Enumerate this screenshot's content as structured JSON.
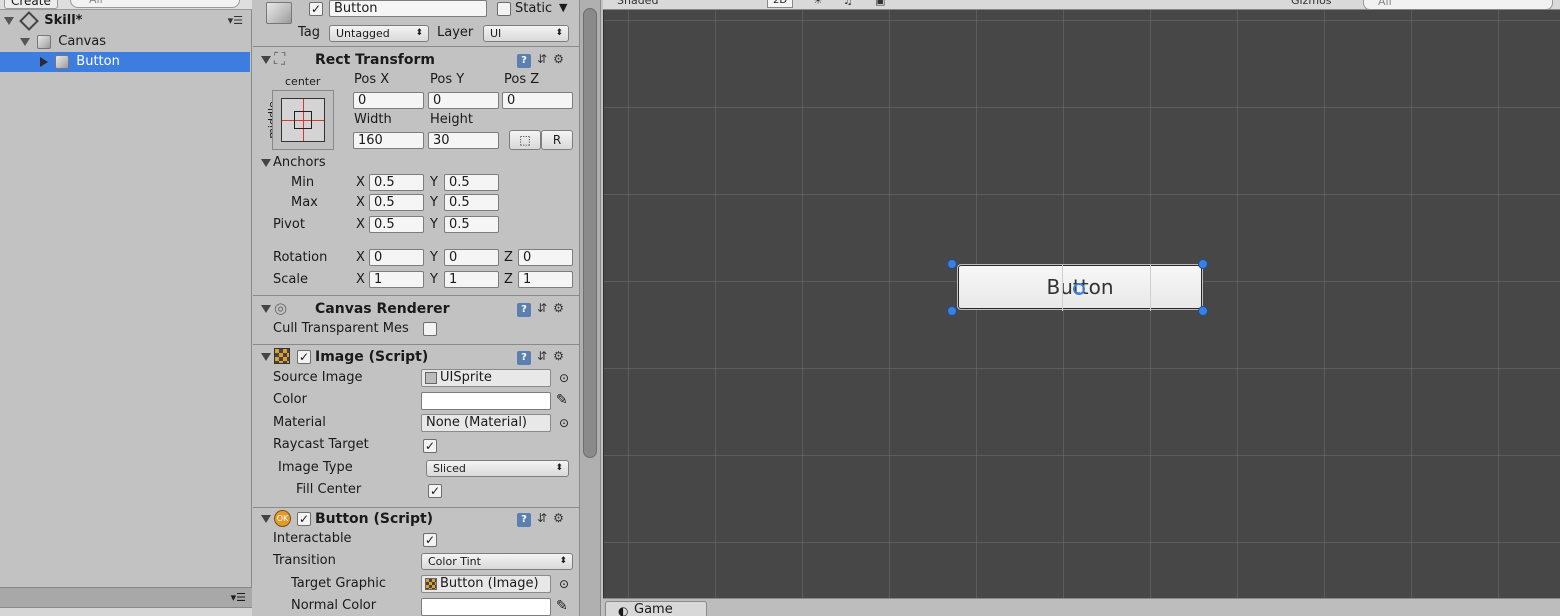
{
  "hierarchy": {
    "create_label": "Create",
    "search_placeholder": "All",
    "scene_name": "Skill*",
    "items": [
      {
        "label": "Canvas"
      },
      {
        "label": "Button"
      }
    ]
  },
  "inspector": {
    "object_name": "Button",
    "static_label": "Static",
    "tag_label": "Tag",
    "tag_value": "Untagged",
    "layer_label": "Layer",
    "layer_value": "UI",
    "rect_transform": {
      "title": "Rect Transform",
      "anchor_h": "center",
      "anchor_v": "middle",
      "pos_x_label": "Pos X",
      "pos_y_label": "Pos Y",
      "pos_z_label": "Pos Z",
      "pos_x": "0",
      "pos_y": "0",
      "pos_z": "0",
      "width_label": "Width",
      "height_label": "Height",
      "width": "160",
      "height": "30",
      "r_label": "R",
      "anchors_label": "Anchors",
      "min_label": "Min",
      "max_label": "Max",
      "pivot_label": "Pivot",
      "min_x": "0.5",
      "min_y": "0.5",
      "max_x": "0.5",
      "max_y": "0.5",
      "pivot_x": "0.5",
      "pivot_y": "0.5",
      "rotation_label": "Rotation",
      "scale_label": "Scale",
      "rot_x": "0",
      "rot_y": "0",
      "rot_z": "0",
      "scale_x": "1",
      "scale_y": "1",
      "scale_z": "1",
      "x": "X",
      "y": "Y",
      "z": "Z"
    },
    "canvas_renderer": {
      "title": "Canvas Renderer",
      "cull_label": "Cull Transparent Mes"
    },
    "image_script": {
      "title": "Image (Script)",
      "source_image_label": "Source Image",
      "source_image_value": "UISprite",
      "color_label": "Color",
      "material_label": "Material",
      "material_value": "None (Material)",
      "raycast_label": "Raycast Target",
      "image_type_label": "Image Type",
      "image_type_value": "Sliced",
      "fill_center_label": "Fill Center"
    },
    "button_script": {
      "title": "Button (Script)",
      "interactable_label": "Interactable",
      "transition_label": "Transition",
      "transition_value": "Color Tint",
      "target_graphic_label": "Target Graphic",
      "target_graphic_value": "Button (Image)",
      "normal_color_label": "Normal Color"
    }
  },
  "scene": {
    "shading_mode": "Shaded",
    "mode_2d": "2D",
    "gizmos_label": "Gizmos",
    "search_placeholder": "All",
    "button_text": "Button",
    "game_tab": "Game"
  },
  "colors": {
    "selection": "#3e7de0",
    "scene_bg": "#474747",
    "handle": "#3a80e0"
  }
}
